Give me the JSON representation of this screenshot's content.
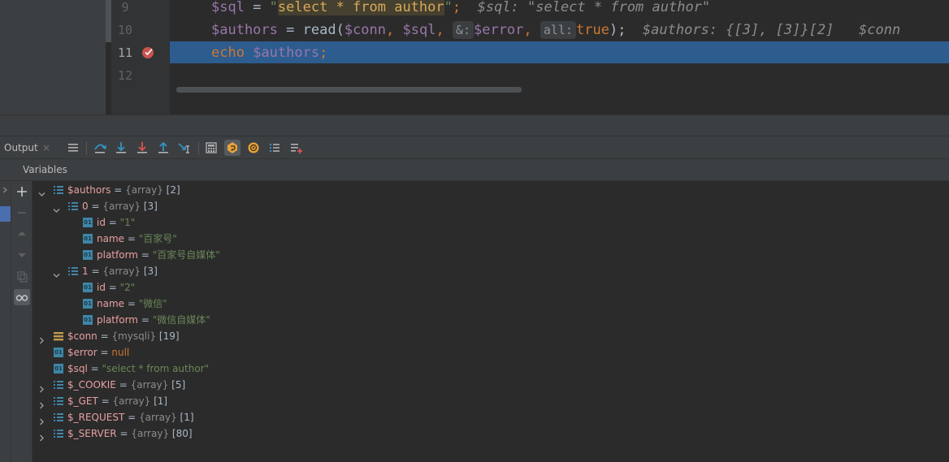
{
  "editor": {
    "lines": [
      {
        "no": "9",
        "code": [
          {
            "t": "$sql",
            "c": "v"
          },
          {
            "t": " = ",
            "c": "p"
          },
          {
            "t": "\"",
            "c": "s"
          },
          {
            "t": "select * from author",
            "c": "sh"
          },
          {
            "t": "\"",
            "c": "s"
          },
          {
            "t": ";",
            "c": "k"
          },
          {
            "t": "  $sql: \"select * from author\"",
            "c": "cm"
          }
        ]
      },
      {
        "no": "10",
        "code": [
          {
            "t": "$authors",
            "c": "v"
          },
          {
            "t": " = ",
            "c": "p"
          },
          {
            "t": "read",
            "c": "f"
          },
          {
            "t": "(",
            "c": "p"
          },
          {
            "t": "$conn",
            "c": "v"
          },
          {
            "t": ", ",
            "c": "k"
          },
          {
            "t": "$sql",
            "c": "v"
          },
          {
            "t": ", ",
            "c": "k"
          },
          {
            "t": "&:",
            "c": "hint"
          },
          {
            "t": "$error",
            "c": "v"
          },
          {
            "t": ", ",
            "c": "k"
          },
          {
            "t": "all:",
            "c": "hint"
          },
          {
            "t": "true",
            "c": "k"
          },
          {
            "t": ");",
            "c": "p"
          },
          {
            "t": "  $authors: {[3], [3]}[2]   $conn",
            "c": "cm"
          }
        ]
      },
      {
        "no": "11",
        "code": [
          {
            "t": "echo ",
            "c": "k"
          },
          {
            "t": "$authors",
            "c": "v"
          },
          {
            "t": ";",
            "c": "k"
          }
        ]
      },
      {
        "no": "12",
        "code": []
      }
    ]
  },
  "toolbar": {
    "output_tab": "Output",
    "close_glyph": "×"
  },
  "variables": {
    "title": "Variables",
    "rows": [
      {
        "depth": 0,
        "expand": "open",
        "icon": "array",
        "name": "$authors",
        "eq": " = ",
        "type": "{array}",
        "count": " [2]"
      },
      {
        "depth": 1,
        "expand": "open",
        "icon": "array",
        "name": "0",
        "eq": " = ",
        "type": "{array}",
        "count": " [3]"
      },
      {
        "depth": 2,
        "expand": "none",
        "icon": "prim",
        "name": "id",
        "eq": " = ",
        "str": "\"1\""
      },
      {
        "depth": 2,
        "expand": "none",
        "icon": "prim",
        "name": "name",
        "eq": " = ",
        "str": "\"百家号\""
      },
      {
        "depth": 2,
        "expand": "none",
        "icon": "prim",
        "name": "platform",
        "eq": " = ",
        "str": "\"百家号自媒体\""
      },
      {
        "depth": 1,
        "expand": "open",
        "icon": "array",
        "name": "1",
        "eq": " = ",
        "type": "{array}",
        "count": " [3]"
      },
      {
        "depth": 2,
        "expand": "none",
        "icon": "prim",
        "name": "id",
        "eq": " = ",
        "str": "\"2\""
      },
      {
        "depth": 2,
        "expand": "none",
        "icon": "prim",
        "name": "name",
        "eq": " = ",
        "str": "\"微信\""
      },
      {
        "depth": 2,
        "expand": "none",
        "icon": "prim",
        "name": "platform",
        "eq": " = ",
        "str": "\"微信自媒体\""
      },
      {
        "depth": 0,
        "expand": "closed",
        "icon": "object",
        "name": "$conn",
        "eq": " = ",
        "type": "{mysqli}",
        "count": " [19]"
      },
      {
        "depth": 0,
        "expand": "none",
        "icon": "prim",
        "name": "$error",
        "eq": " = ",
        "nul": "null"
      },
      {
        "depth": 0,
        "expand": "none",
        "icon": "prim",
        "name": "$sql",
        "eq": " = ",
        "str": "\"select * from author\""
      },
      {
        "depth": 0,
        "expand": "closed",
        "icon": "array",
        "name": "$_COOKIE",
        "eq": " = ",
        "type": "{array}",
        "count": " [5]"
      },
      {
        "depth": 0,
        "expand": "closed",
        "icon": "array",
        "name": "$_GET",
        "eq": " = ",
        "type": "{array}",
        "count": " [1]"
      },
      {
        "depth": 0,
        "expand": "closed",
        "icon": "array",
        "name": "$_REQUEST",
        "eq": " = ",
        "type": "{array}",
        "count": " [1]"
      },
      {
        "depth": 0,
        "expand": "closed",
        "icon": "array",
        "name": "$_SERVER",
        "eq": " = ",
        "type": "{array}",
        "count": " [80]"
      }
    ]
  },
  "colors": {
    "highlight_line": "#2d5c8f",
    "breakpoint": "#c75450",
    "variable_name": "#e8a0a0",
    "string_value": "#6a8759"
  }
}
